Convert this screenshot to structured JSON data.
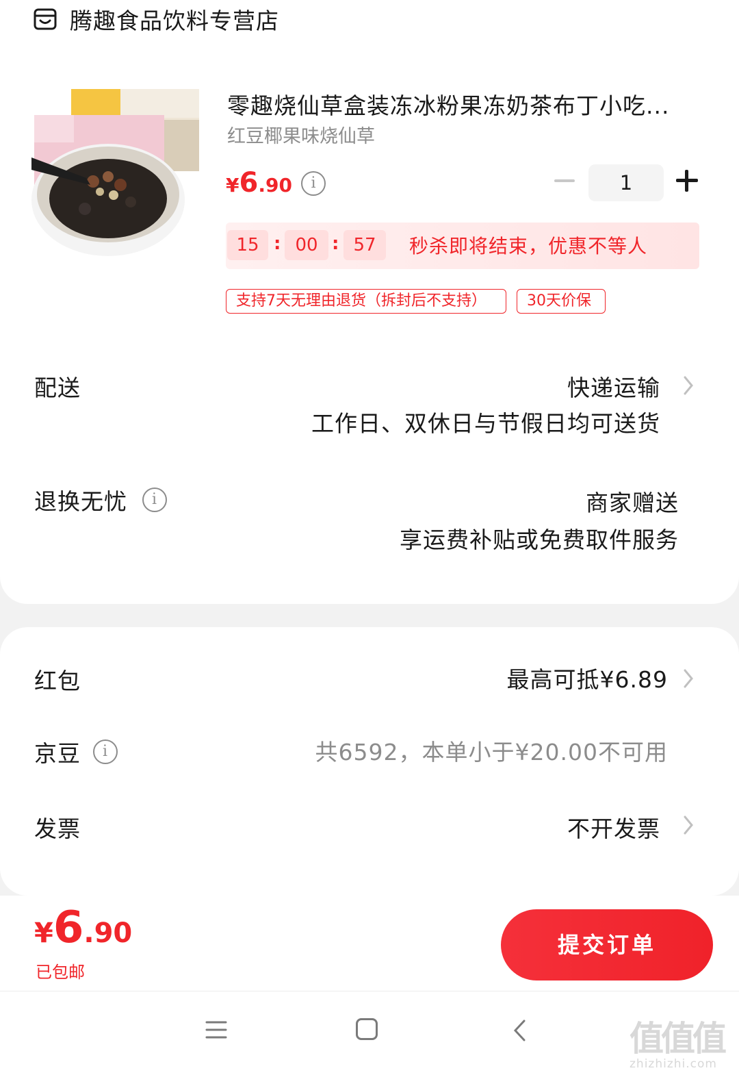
{
  "store": {
    "name": "腾趣食品饮料专营店",
    "icon": "store-icon"
  },
  "product": {
    "title": "零趣烧仙草盒装冻冰粉果冻奶茶布丁小吃...",
    "variant": "红豆椰果味烧仙草",
    "price_currency": "¥",
    "price_int": "6",
    "price_dec": ".90",
    "quantity": "1"
  },
  "flash_sale": {
    "hours": "15",
    "minutes": "00",
    "seconds": "57",
    "sep": ":",
    "text": "秒杀即将结束，优惠不等人"
  },
  "tags": [
    "支持7天无理由退货（拆封后不支持）",
    "30天价保"
  ],
  "delivery": {
    "label": "配送",
    "method": "快递运输",
    "detail": "工作日、双休日与节假日均可送货"
  },
  "returns": {
    "label": "退换无忧",
    "value": "商家赠送",
    "detail": "享运费补贴或免费取件服务"
  },
  "red_packet": {
    "label": "红包",
    "value": "最高可抵¥6.89"
  },
  "jd_beans": {
    "label": "京豆",
    "value": "共6592，本单小于¥20.00不可用"
  },
  "invoice": {
    "label": "发票",
    "value": "不开发票"
  },
  "footer": {
    "total_currency": "¥",
    "total_int": "6",
    "total_dec": ".90",
    "shipping_note": "已包邮",
    "submit_label": "提交订单"
  },
  "watermark": {
    "chars": "值值值",
    "url": "zhizhizhi.com"
  },
  "colors": {
    "accent": "#f0252a",
    "muted": "#8c8c8c",
    "background": "#f2f2f2"
  }
}
